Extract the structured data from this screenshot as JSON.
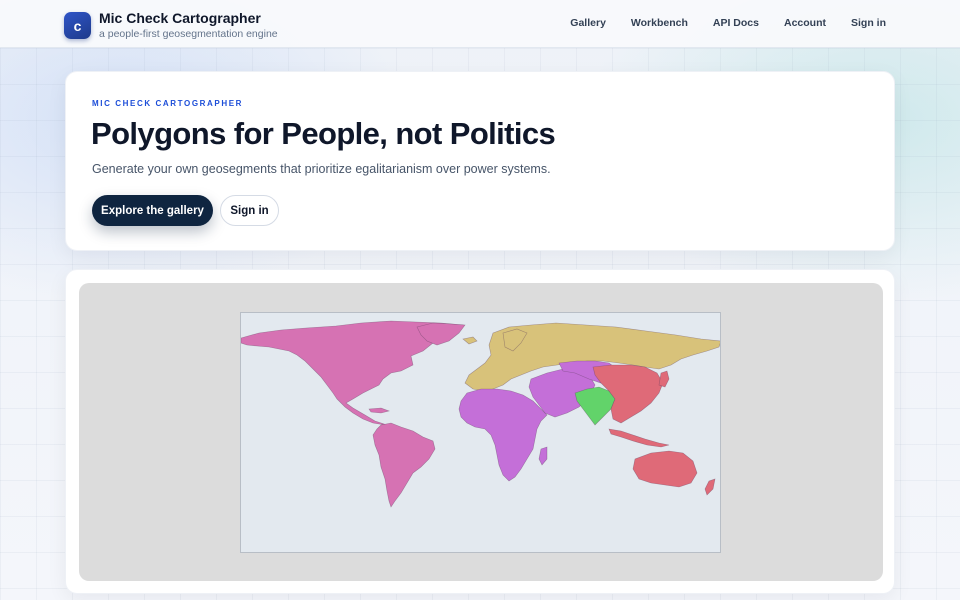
{
  "brand": {
    "logo_letter": "c",
    "title": "Mic Check Cartographer",
    "tagline": "a people-first geosegmentation engine"
  },
  "nav": {
    "items": [
      "Gallery",
      "Workbench",
      "API Docs",
      "Account",
      "Sign in"
    ]
  },
  "hero": {
    "eyebrow": "MIC CHECK CARTOGRAPHER",
    "headline": "Polygons for People, not Politics",
    "subtitle": "Generate your own geosegments that prioritize egalitarianism over power systems.",
    "primary_cta": "Explore the gallery",
    "secondary_cta": "Sign in"
  },
  "map": {
    "segment_colors": {
      "americas": "#d672b3",
      "eurasia_north": "#d8c27a",
      "africa_west_asia": "#c46fd8",
      "south_asia": "#62d36a",
      "east_asia_oceania": "#df6a78",
      "ocean": "#e3e9ef"
    }
  },
  "icons": {
    "logo": "app-logo-icon"
  }
}
